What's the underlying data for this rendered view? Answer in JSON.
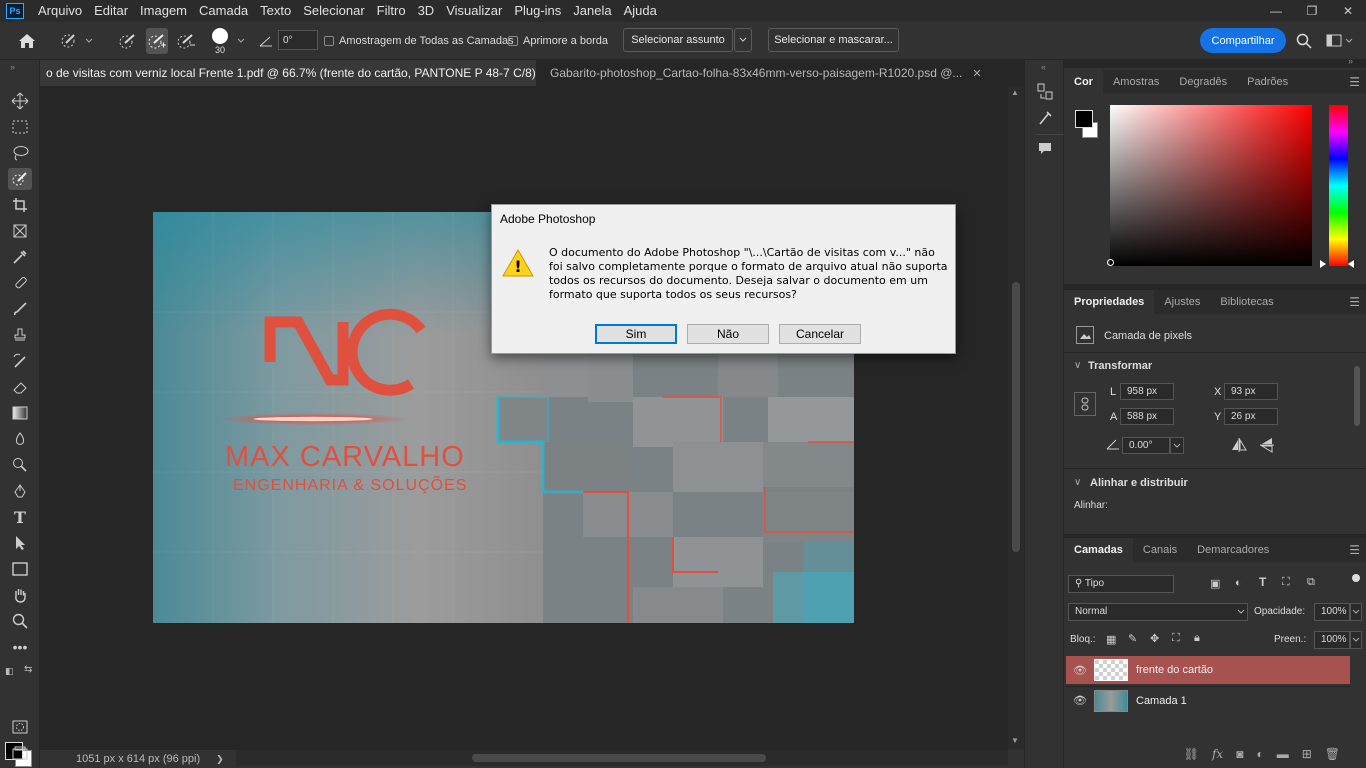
{
  "app": {
    "logo": "Ps"
  },
  "menu": [
    "Arquivo",
    "Editar",
    "Imagem",
    "Camada",
    "Texto",
    "Selecionar",
    "Filtro",
    "3D",
    "Visualizar",
    "Plug-ins",
    "Janela",
    "Ajuda"
  ],
  "window_controls": {
    "minimize": "—",
    "restore": "❐",
    "close": "✕"
  },
  "options": {
    "brush_size": "30",
    "angle": "0°",
    "sample_all": "Amostragem de Todas as Camadas",
    "enhance_edge": "Aprimore a borda",
    "select_subject": "Selecionar assunto",
    "select_mask": "Selecionar e mascarar...",
    "share": "Compartilhar"
  },
  "tabs": [
    {
      "label": "o de visitas com verniz local Frente 1.pdf @ 66.7% (frente do cartão, PANTONE P 48-7 C/8) *",
      "close": "✕"
    },
    {
      "label": "Gabarito-photoshop_Cartao-folha-83x46mm-verso-paisagem-R1020.psd @...",
      "close": "✕"
    }
  ],
  "artwork": {
    "logo_letters": "MC",
    "brand": "MAX CARVALHO",
    "tagline": "ENGENHARIA & SOLUÇÕES"
  },
  "status": {
    "doc_size": "1051 px x 614 px (96 ppi)",
    "arrow": "❯"
  },
  "dialog": {
    "title": "Adobe Photoshop",
    "message": "O documento do Adobe Photoshop \"\\...\\Cartão de visitas com v...\" não foi salvo completamente porque o formato de arquivo atual não suporta todos os recursos do documento. Deseja salvar o documento em um formato que suporta todos os seus recursos?",
    "buttons": {
      "yes": "Sim",
      "no": "Não",
      "cancel": "Cancelar"
    },
    "warning_glyph": "!"
  },
  "color_panel": {
    "tabs": [
      "Cor",
      "Amostras",
      "Degradês",
      "Padrões"
    ]
  },
  "properties_panel": {
    "tabs": [
      "Propriedades",
      "Ajustes",
      "Bibliotecas"
    ],
    "type": "Camada de pixels",
    "transform": "Transformar",
    "W_label": "L",
    "W": "958 px",
    "H_label": "A",
    "H": "588 px",
    "X_label": "X",
    "X": "93 px",
    "Y_label": "Y",
    "Y": "26 px",
    "angle": "0.00°",
    "align": "Alinhar e distribuir",
    "align_label": "Alinhar:"
  },
  "layers_panel": {
    "tabs": [
      "Camadas",
      "Canais",
      "Demarcadores"
    ],
    "filter": "Tipo",
    "blend": "Normal",
    "opacity_label": "Opacidade:",
    "opacity": "100%",
    "lock_label": "Bloq.:",
    "fill_label": "Preen.:",
    "fill": "100%",
    "layers": [
      {
        "name": "frente do cartão",
        "selected": true
      },
      {
        "name": "Camada 1",
        "selected": false
      }
    ]
  }
}
